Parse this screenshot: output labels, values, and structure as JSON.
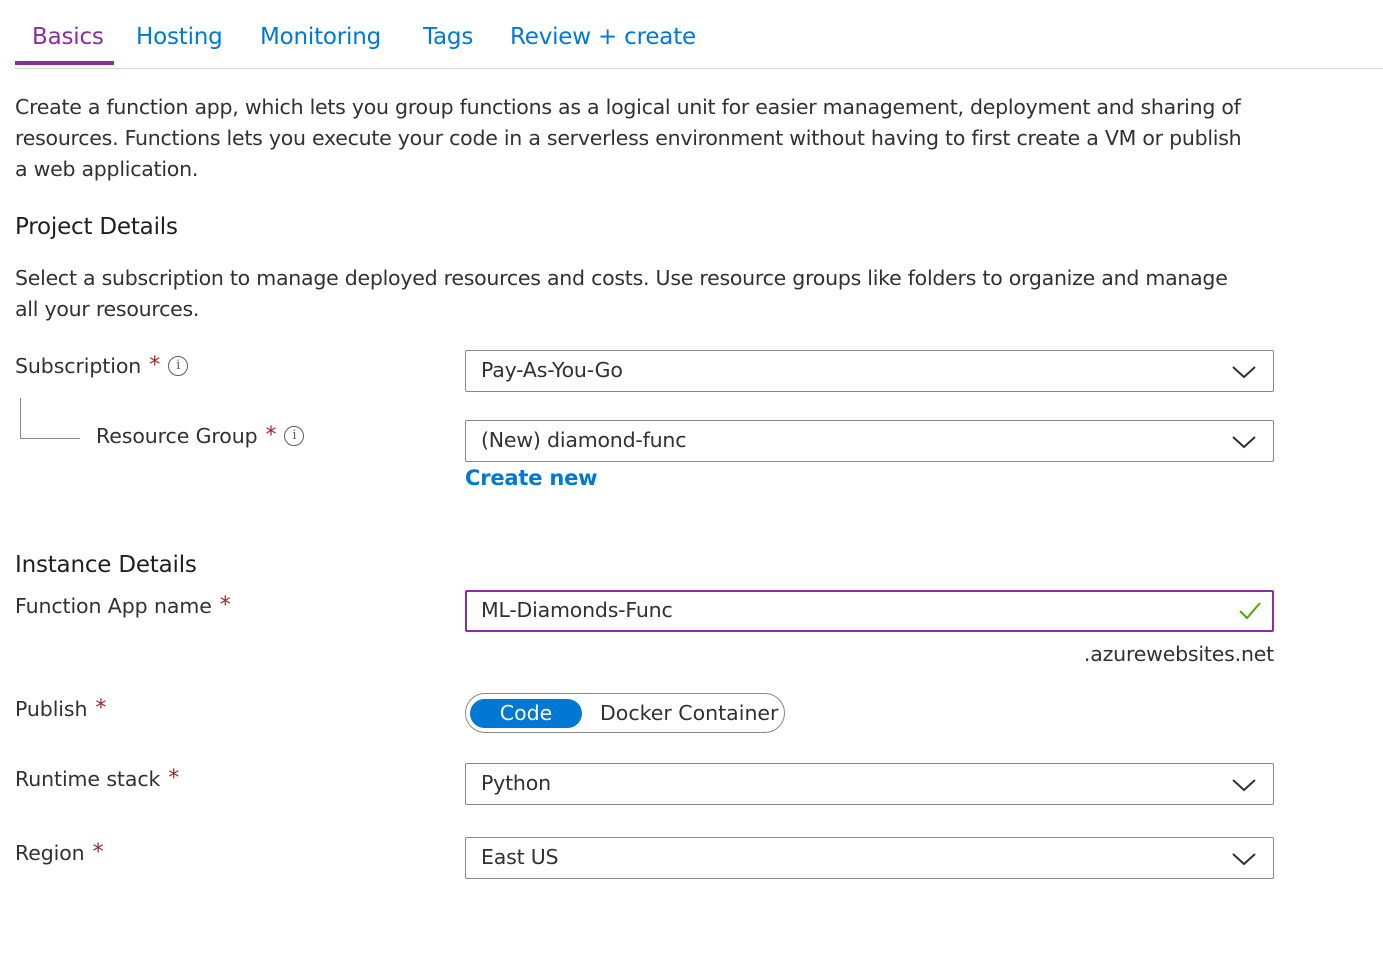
{
  "tabs": [
    {
      "label": "Basics",
      "active": true
    },
    {
      "label": "Hosting",
      "active": false
    },
    {
      "label": "Monitoring",
      "active": false
    },
    {
      "label": "Tags",
      "active": false
    },
    {
      "label": "Review + create",
      "active": false
    }
  ],
  "intro": {
    "line1": "Create a function app, which lets you group functions as a logical unit for easier management, deployment and sharing of",
    "line2": "resources. Functions lets you execute your code in a serverless environment without having to first create a VM or publish",
    "line3": "a web application."
  },
  "project_details": {
    "title": "Project Details",
    "desc_line1": "Select a subscription to manage deployed resources and costs. Use resource groups like folders to organize and manage",
    "desc_line2": "all your resources.",
    "subscription": {
      "label": "Subscription",
      "required_mark": "*",
      "info_icon": "i",
      "value": "Pay-As-You-Go"
    },
    "resource_group": {
      "label": "Resource Group",
      "required_mark": "*",
      "info_icon": "i",
      "value": "(New) diamond-func",
      "create_new": "Create new"
    }
  },
  "instance_details": {
    "title": "Instance Details",
    "function_app_name": {
      "label": "Function App name",
      "required_mark": "*",
      "value": "ML-Diamonds-Func",
      "suffix": ".azurewebsites.net",
      "valid": true
    },
    "publish": {
      "label": "Publish",
      "required_mark": "*",
      "options": [
        "Code",
        "Docker Container"
      ],
      "selected": "Code"
    },
    "runtime_stack": {
      "label": "Runtime stack",
      "required_mark": "*",
      "value": "Python"
    },
    "region": {
      "label": "Region",
      "required_mark": "*",
      "value": "East US"
    }
  },
  "colors": {
    "accent_purple": "#8a2da5",
    "link_blue": "#0078d4",
    "required_red": "#a4262c",
    "valid_green": "#57a300",
    "border_gray": "#8a8886"
  }
}
